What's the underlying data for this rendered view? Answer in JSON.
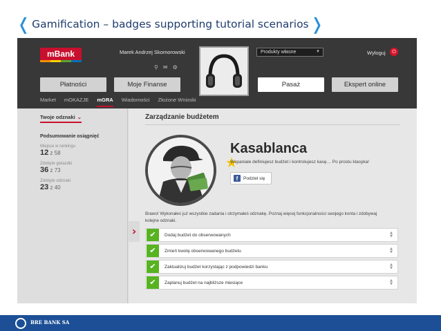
{
  "slide": {
    "title": "Gamification – badges supporting tutorial scenarios",
    "footer_text": "BRE BANK SA"
  },
  "header": {
    "logo": "mBank",
    "username": "Marek Andrzej Skomorowski",
    "products_select": "Produkty własne",
    "logout": "Wyloguj",
    "icons": [
      "pin-icon",
      "mail-icon",
      "gear-icon"
    ]
  },
  "nav": {
    "buttons": [
      "Płatności",
      "Moje Finanse",
      "Pasaż",
      "Ekspert online"
    ],
    "active_button": "Pasaż"
  },
  "subnav": {
    "items": [
      "Market",
      "mOKAZJE",
      "mGRA",
      "Wiadomości",
      "Złożone Wnioski"
    ],
    "active": "mGRA"
  },
  "sidebar": {
    "header": "Twoje odznaki",
    "summary_title": "Podsumowanie osiągnięć",
    "stats": [
      {
        "label": "Miejsce w rankingu",
        "value": "12",
        "suffix": "z 58"
      },
      {
        "label": "Zdobyte gwiazdki",
        "value": "36",
        "suffix": "z 73"
      },
      {
        "label": "Zdobyte odznaki",
        "value": "23",
        "suffix": "z 40"
      }
    ]
  },
  "main": {
    "title": "Zarządzanie budżetem",
    "badge_name": "Kasablanca",
    "badge_description": "Wspaniale definiujesz budżet i kontrolujesz kasę… Po prostu klasyka!",
    "share_label": "Podziel się",
    "bravo_text": "Brawo! Wykonałeś już wszystkie zadania i otrzymałeś odznakę. Poznaj więcej funkcjonalności swojego konta i zdobywaj kolejne odznaki.",
    "tasks": [
      {
        "label": "Dodaj budżet do obserwowanych",
        "done": true
      },
      {
        "label": "Zmień kwotę obserwowanego budżetu",
        "done": true
      },
      {
        "label": "Zaktualizuj budżet korzystając z podpowiedzi banku",
        "done": true
      },
      {
        "label": "Zaplanuj budżet na najbliższe miesiące",
        "done": true
      }
    ]
  },
  "colors": {
    "brand_red": "#c8102e",
    "check_green": "#57b321",
    "footer_blue": "#1c4f95",
    "title_bracket": "#2a8fd8"
  }
}
